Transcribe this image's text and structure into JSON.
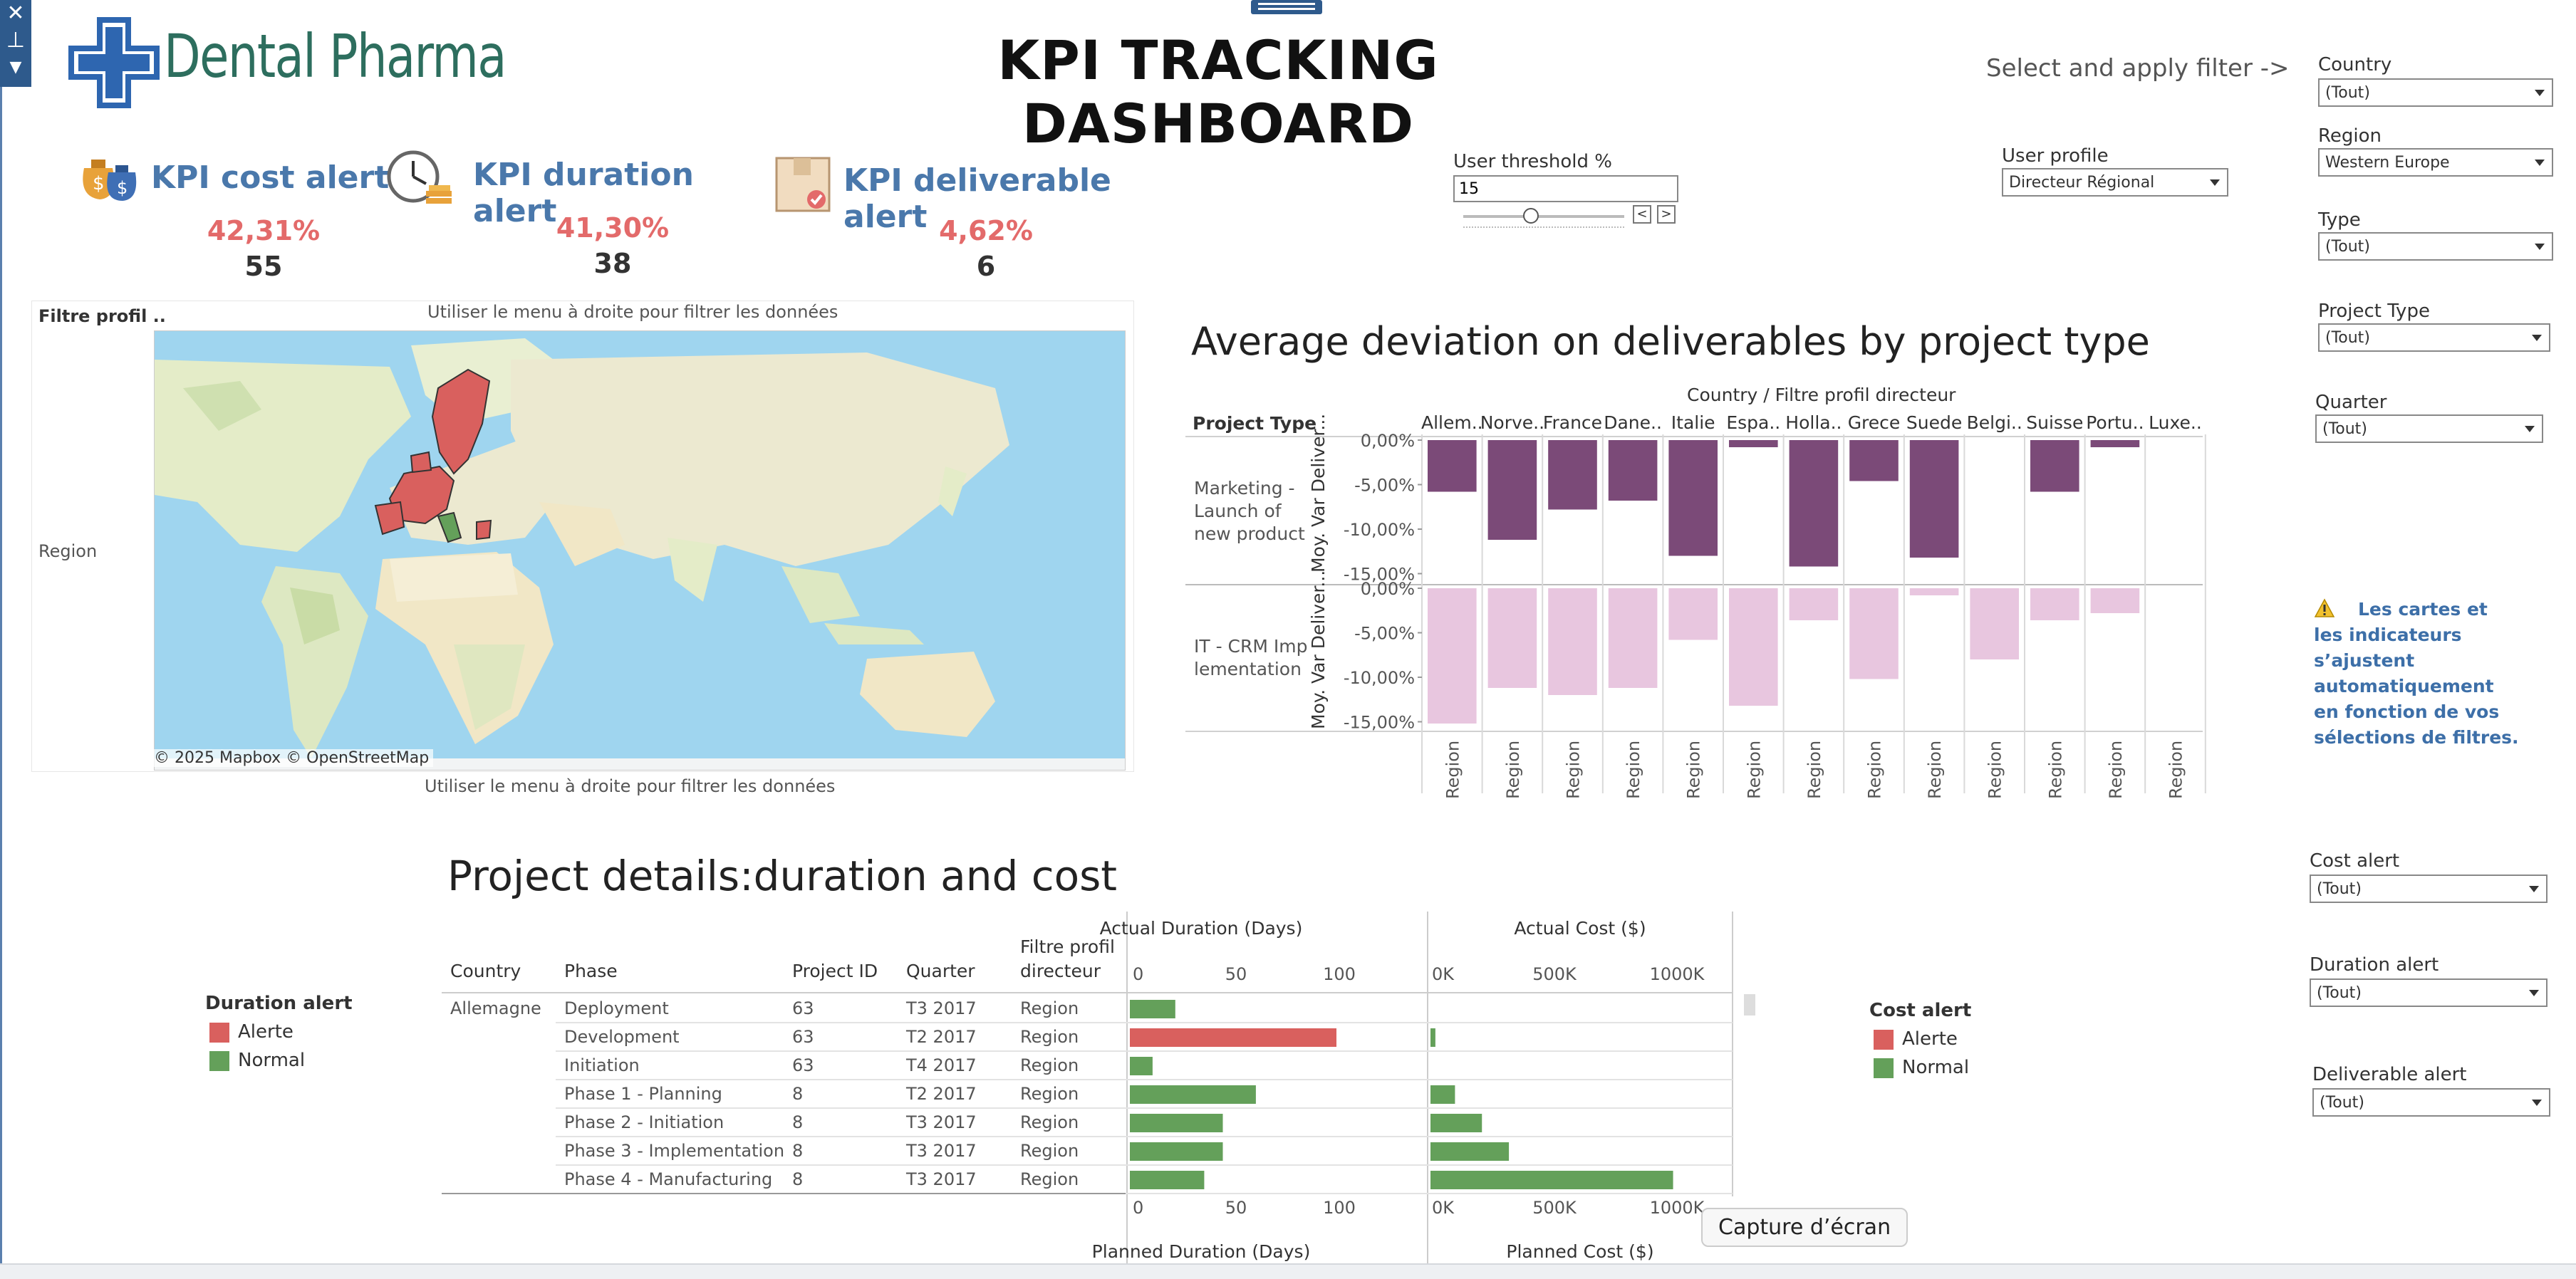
{
  "app": {
    "brand": "Dental Pharma",
    "title": "KPI TRACKING DASHBOARD",
    "filter_hint": "Select and apply filter ->"
  },
  "kpis": [
    {
      "title": "KPI cost alert",
      "pct": "42,31%",
      "count": "55",
      "icon": "money-bag-icon"
    },
    {
      "title": "KPI duration alert",
      "pct": "41,30%",
      "count": "38",
      "icon": "clock-icon"
    },
    {
      "title": "KPI deliverable alert",
      "pct": "4,62%",
      "count": "6",
      "icon": "package-icon"
    }
  ],
  "threshold": {
    "label": "User threshold %",
    "value": "15"
  },
  "user_profile": {
    "label": "User profile",
    "value": "Directeur Régional"
  },
  "filters": {
    "country": {
      "label": "Country",
      "value": "(Tout)"
    },
    "region": {
      "label": "Region",
      "value": "Western Europe"
    },
    "type": {
      "label": "Type",
      "value": "(Tout)"
    },
    "project_type": {
      "label": "Project Type",
      "value": "(Tout)"
    },
    "quarter": {
      "label": "Quarter",
      "value": "(Tout)"
    },
    "cost_alert": {
      "label": "Cost alert",
      "value": "(Tout)"
    },
    "duration_alert": {
      "label": "Duration alert",
      "value": "(Tout)"
    },
    "deliverable_alert": {
      "label": "Deliverable alert",
      "value": "(Tout)"
    }
  },
  "map_section": {
    "filter_label": "Filtre profil ..",
    "row_label": "Region",
    "hint_top": "Utiliser le menu à droite pour filtrer les données",
    "hint_bottom": "Utiliser le menu à droite pour filtrer les données",
    "credit": "© 2025 Mapbox  © OpenStreetMap"
  },
  "info_note": "Les cartes et les indicateurs s’ajustent automatiquement en fonction de vos sélections de filtres.",
  "colors": {
    "alert": "#d9605e",
    "normal": "#64a05a",
    "marketing": "#7b4a78",
    "it": "#e8c6df",
    "kpi_title": "#4a78ab"
  },
  "chart_data": [
    {
      "type": "bar",
      "title": "Average deviation on deliverables by project type",
      "column_header": "Country / Filtre profil directeur",
      "row_header": "Project Type",
      "ylabel": "Moy. Var Deliver...",
      "categories": [
        "Allem..",
        "Norve..",
        "France",
        "Dane..",
        "Italie",
        "Espa..",
        "Holla..",
        "Grece",
        "Suede",
        "Belgi..",
        "Suisse",
        "Portu..",
        "Luxe.."
      ],
      "sub_label": "Region",
      "yticks": [
        "0,00%",
        "-5,00%",
        "-10,00%",
        "-15,00%"
      ],
      "ylim": [
        -16,
        0
      ],
      "series": [
        {
          "name": "Marketing - Launch of new product",
          "values": [
            -5.8,
            -11.2,
            -7.8,
            -6.8,
            -13,
            -0.8,
            -14.2,
            -4.6,
            -13.2,
            0,
            -5.8,
            -0.8,
            0
          ]
        },
        {
          "name": "IT -  CRM Imp lementation",
          "values": [
            -15.2,
            -11.2,
            -12,
            -11.2,
            -5.8,
            -13.2,
            -3.6,
            -10.2,
            -0.8,
            -8,
            -3.6,
            -2.8,
            0
          ]
        }
      ]
    },
    {
      "type": "bar",
      "title": "Project details:duration and cost",
      "columns": [
        "Country",
        "Phase",
        "Project ID",
        "Quarter",
        "Filtre profil directeur"
      ],
      "rows": [
        {
          "country": "Allemagne",
          "phase": "Deployment",
          "id": "63",
          "quarter": "T3 2017",
          "filtre": "Region",
          "duration": 22,
          "cost": 0,
          "duration_alert": "Normal"
        },
        {
          "country": "",
          "phase": "Development",
          "id": "63",
          "quarter": "T2 2017",
          "filtre": "Region",
          "duration": 100,
          "cost": 20,
          "duration_alert": "Alerte"
        },
        {
          "country": "",
          "phase": "Initiation",
          "id": "63",
          "quarter": "T4 2017",
          "filtre": "Region",
          "duration": 11,
          "cost": 0,
          "duration_alert": "Normal"
        },
        {
          "country": "",
          "phase": "Phase 1 - Planning",
          "id": "8",
          "quarter": "T2 2017",
          "filtre": "Region",
          "duration": 61,
          "cost": 100,
          "duration_alert": "Normal"
        },
        {
          "country": "",
          "phase": "Phase 2 - Initiation",
          "id": "8",
          "quarter": "T3 2017",
          "filtre": "Region",
          "duration": 45,
          "cost": 210,
          "duration_alert": "Normal"
        },
        {
          "country": "",
          "phase": "Phase 3 - Implementation",
          "id": "8",
          "quarter": "T3 2017",
          "filtre": "Region",
          "duration": 45,
          "cost": 320,
          "duration_alert": "Normal"
        },
        {
          "country": "",
          "phase": "Phase 4 - Manufacturing",
          "id": "8",
          "quarter": "T3 2017",
          "filtre": "Region",
          "duration": 36,
          "cost": 990,
          "duration_alert": "Normal"
        }
      ],
      "duration_axis": {
        "title_top": "Actual Duration (Days)",
        "title_bottom": "Planned Duration (Days)",
        "ticks": [
          "0",
          "50",
          "100"
        ],
        "max": 100
      },
      "cost_axis": {
        "title_top": "Actual Cost ($)",
        "title_bottom": "Planned Cost ($)",
        "ticks": [
          "0K",
          "500K",
          "1000K"
        ],
        "max": 1000
      }
    }
  ],
  "legends": {
    "duration": {
      "title": "Duration alert",
      "items": [
        "Alerte",
        "Normal"
      ]
    },
    "cost": {
      "title": "Cost alert",
      "items": [
        "Alerte",
        "Normal"
      ]
    }
  },
  "tooltip": "Capture d’écran"
}
